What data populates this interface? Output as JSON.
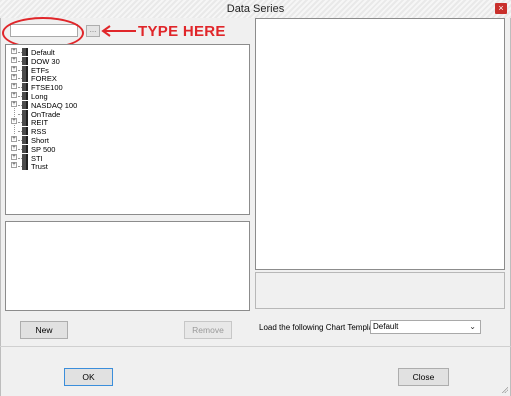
{
  "window": {
    "title": "Data Series",
    "close_label": "×"
  },
  "annotation": {
    "text": "TYPE HERE",
    "color": "#e0262a"
  },
  "search": {
    "value": "",
    "button_label": "…"
  },
  "tree": {
    "items": [
      {
        "label": "Default",
        "expandable": true
      },
      {
        "label": "DOW 30",
        "expandable": true
      },
      {
        "label": "ETFs",
        "expandable": true
      },
      {
        "label": "FOREX",
        "expandable": true
      },
      {
        "label": "FTSE100",
        "expandable": true
      },
      {
        "label": "Long",
        "expandable": true
      },
      {
        "label": "NASDAQ 100",
        "expandable": true
      },
      {
        "label": "OnTrade",
        "expandable": false
      },
      {
        "label": "REIT",
        "expandable": true
      },
      {
        "label": "RSS",
        "expandable": false
      },
      {
        "label": "Short",
        "expandable": true
      },
      {
        "label": "SP 500",
        "expandable": true
      },
      {
        "label": "STI",
        "expandable": true
      },
      {
        "label": "Trust",
        "expandable": true
      }
    ]
  },
  "buttons": {
    "new": "New",
    "remove": "Remove",
    "ok": "OK",
    "close": "Close"
  },
  "template": {
    "label": "Load the following Chart Template:",
    "selected": "Default"
  }
}
